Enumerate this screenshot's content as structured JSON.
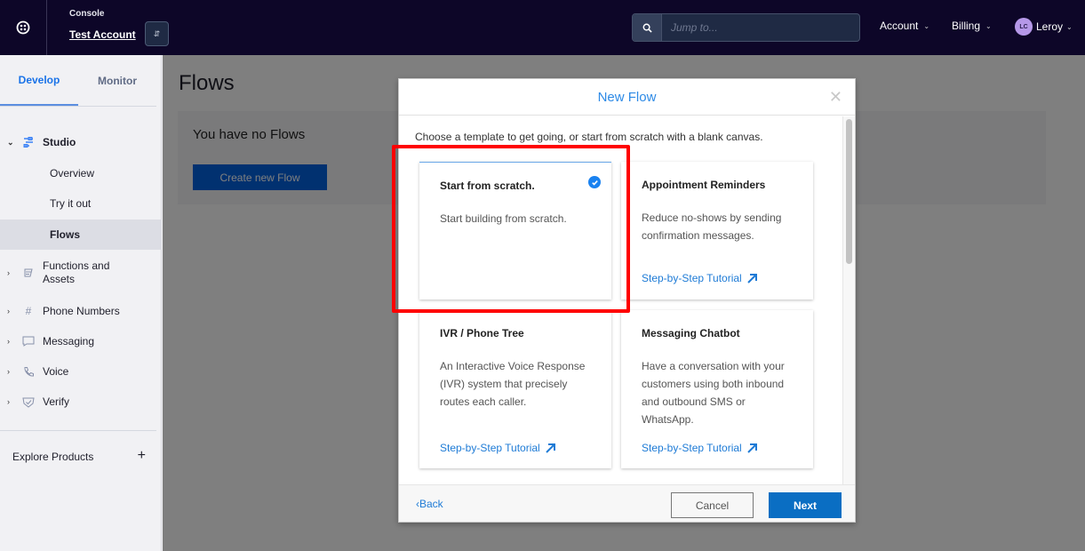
{
  "topbar": {
    "logo_icon": "twilio-logo-icon",
    "console_label": "Console",
    "account_name": "Test Account",
    "account_switch_icon": "up-down-chevron-icon",
    "search": {
      "icon": "search-icon",
      "placeholder": "Jump to..."
    },
    "menus": [
      {
        "label": "Account",
        "icon": "chevron-down-icon"
      },
      {
        "label": "Billing",
        "icon": "chevron-down-icon"
      }
    ],
    "user": {
      "initials": "LC",
      "name": "Leroy",
      "icon": "chevron-down-icon"
    }
  },
  "sidebar": {
    "tabs": [
      {
        "label": "Develop",
        "active": true
      },
      {
        "label": "Monitor",
        "active": false
      }
    ],
    "studio": {
      "label": "Studio",
      "icon": "studio-icon",
      "expanded": true,
      "children": [
        {
          "label": "Overview",
          "active": false
        },
        {
          "label": "Try it out",
          "active": false
        },
        {
          "label": "Flows",
          "active": true
        }
      ]
    },
    "items": [
      {
        "label_line1": "Functions and",
        "label_line2": "Assets",
        "icon": "functions-icon"
      },
      {
        "label": "Phone Numbers",
        "icon": "hash-icon"
      },
      {
        "label": "Messaging",
        "icon": "chat-bubble-icon"
      },
      {
        "label": "Voice",
        "icon": "phone-icon"
      },
      {
        "label": "Verify",
        "icon": "verify-shield-icon"
      }
    ],
    "explore": {
      "label": "Explore Products",
      "icon": "plus-icon"
    }
  },
  "main": {
    "title": "Flows",
    "empty_text": "You have no Flows",
    "create_button": "Create new Flow"
  },
  "modal": {
    "title": "New Flow",
    "close_icon": "close-icon",
    "intro": "Choose a template to get going, or start from scratch with a blank canvas.",
    "templates": [
      {
        "title": "Start from scratch.",
        "description": "Start building from scratch.",
        "selected": true,
        "link": null
      },
      {
        "title": "Appointment Reminders",
        "description": "Reduce no-shows by sending confirmation messages.",
        "selected": false,
        "link": "Step-by-Step Tutorial"
      },
      {
        "title": "IVR / Phone Tree",
        "description": "An Interactive Voice Response (IVR) system that precisely routes each caller.",
        "selected": false,
        "link": "Step-by-Step Tutorial"
      },
      {
        "title": "Messaging Chatbot",
        "description": "Have a conversation with your customers using both inbound and outbound SMS or WhatsApp.",
        "selected": false,
        "link": "Step-by-Step Tutorial"
      }
    ],
    "footer": {
      "back": "Back",
      "cancel": "Cancel",
      "next": "Next"
    }
  },
  "colors": {
    "topbar_bg": "#0d0628",
    "accent_blue": "#1a73e8",
    "next_button": "#0a6ec3",
    "highlight": "#ff0000"
  }
}
